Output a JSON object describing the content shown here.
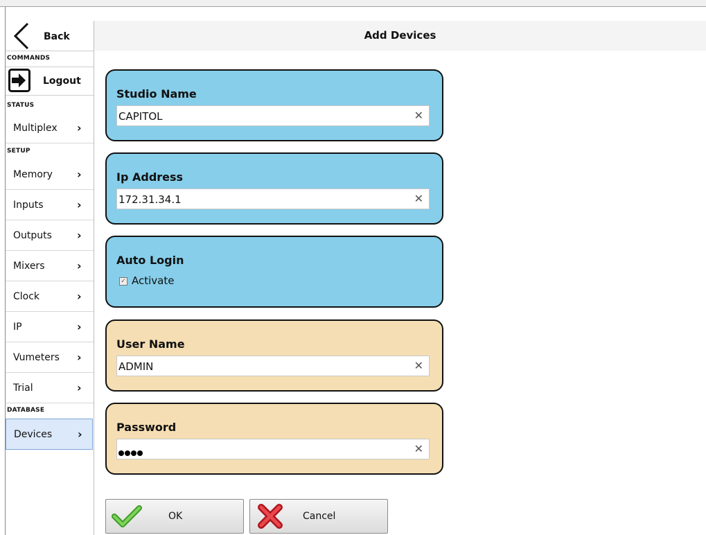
{
  "header": {
    "title": "Add Devices"
  },
  "sidebar": {
    "back_label": "Back",
    "sections": {
      "commands": "COMMANDS",
      "status": "STATUS",
      "setup": "SETUP",
      "database": "DATABASE"
    },
    "logout_label": "Logout",
    "items": [
      {
        "label": "Multiplex"
      },
      {
        "label": "Memory"
      },
      {
        "label": "Inputs"
      },
      {
        "label": "Outputs"
      },
      {
        "label": "Mixers"
      },
      {
        "label": "Clock"
      },
      {
        "label": "IP"
      },
      {
        "label": "Vumeters"
      },
      {
        "label": "Trial"
      },
      {
        "label": "Devices",
        "active": true
      }
    ]
  },
  "form": {
    "studio_name": {
      "label": "Studio Name",
      "value": "CAPITOL"
    },
    "ip_address": {
      "label": "Ip Address",
      "value": "172.31.34.1"
    },
    "auto_login": {
      "label": "Auto Login",
      "checkbox_label": "Activate",
      "checked": true
    },
    "user_name": {
      "label": "User Name",
      "value": "ADMIN"
    },
    "password": {
      "label": "Password",
      "length": 4
    }
  },
  "buttons": {
    "ok_label": "OK",
    "cancel_label": "Cancel"
  },
  "colors": {
    "blue_card": "#87ceea",
    "tan_card": "#f5deb3",
    "active_item": "#dbe9fb"
  }
}
